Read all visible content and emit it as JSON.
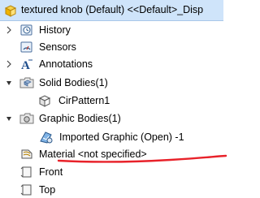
{
  "header": {
    "title": "textured knob (Default) <<Default>_Disp"
  },
  "tree": [
    {
      "label": "History",
      "icon": "history-icon",
      "expander": "collapsed"
    },
    {
      "label": "Sensors",
      "icon": "sensors-icon",
      "expander": "none"
    },
    {
      "label": "Annotations",
      "icon": "annotations-icon",
      "expander": "collapsed"
    },
    {
      "label": "Solid Bodies(1)",
      "icon": "solid-bodies-folder-icon",
      "expander": "expanded"
    },
    {
      "label": "CirPattern1",
      "icon": "solid-body-icon",
      "expander": "none"
    },
    {
      "label": "Graphic Bodies(1)",
      "icon": "graphic-bodies-folder-icon",
      "expander": "expanded"
    },
    {
      "label": "Imported Graphic (Open) -1",
      "icon": "imported-graphic-icon",
      "expander": "none"
    },
    {
      "label": "Material <not specified>",
      "icon": "material-icon",
      "expander": "none"
    },
    {
      "label": "Front",
      "icon": "plane-icon",
      "expander": "none"
    },
    {
      "label": "Top",
      "icon": "plane-icon",
      "expander": "none"
    }
  ],
  "colors": {
    "header_bg": "#cfe4fa",
    "annotation_underline": "#e8222a"
  }
}
